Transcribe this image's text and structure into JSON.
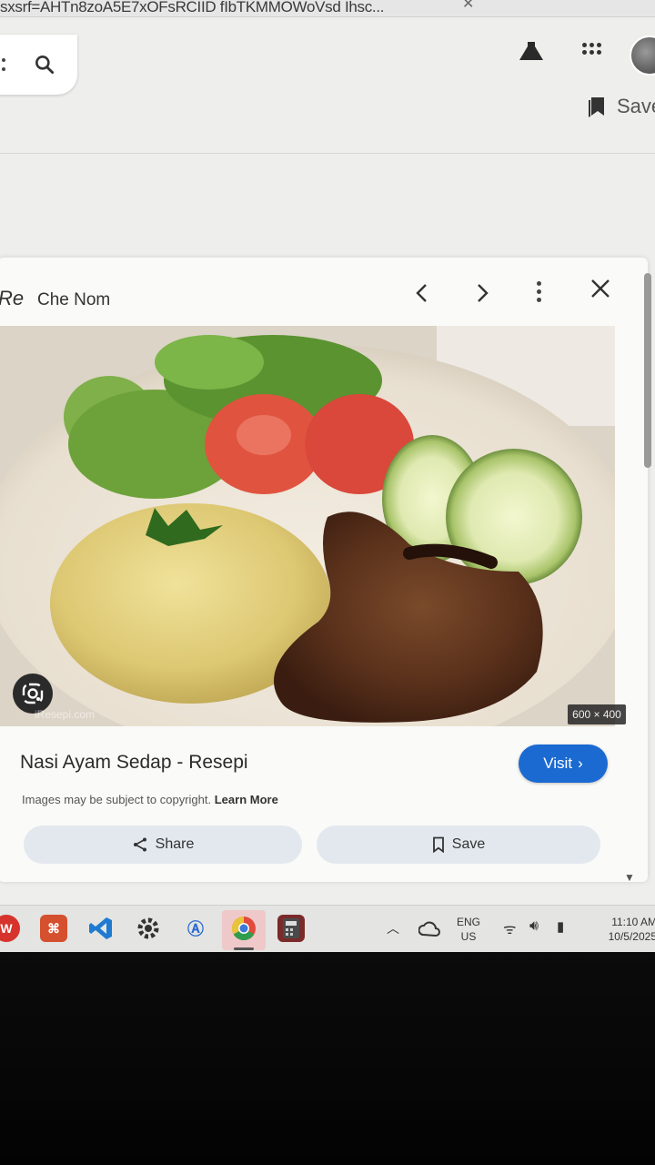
{
  "browser": {
    "url_fragment": "sxsrf=AHTn8zoA5E7xOFsRCIID fIbTKMMOWoVsd Ihsc..."
  },
  "header": {
    "save_label": "Save"
  },
  "panel": {
    "site_logo": "Re",
    "site_name": "Che Nom",
    "image_watermark": "iResepi.com",
    "image_dimensions": "600 × 400",
    "title": "Nasi Ayam Sedap - Resepi",
    "visit_label": "Visit",
    "copyright_text": "Images may be subject to copyright.",
    "learn_more_label": "Learn More",
    "share_label": "Share",
    "save_label": "Save"
  },
  "taskbar": {
    "lang_line1": "ENG",
    "lang_line2": "US",
    "time": "11:10 AM",
    "date": "10/5/2025"
  },
  "colors": {
    "visit_button": "#1a6ad1",
    "chip_background": "#e3e8ef"
  }
}
